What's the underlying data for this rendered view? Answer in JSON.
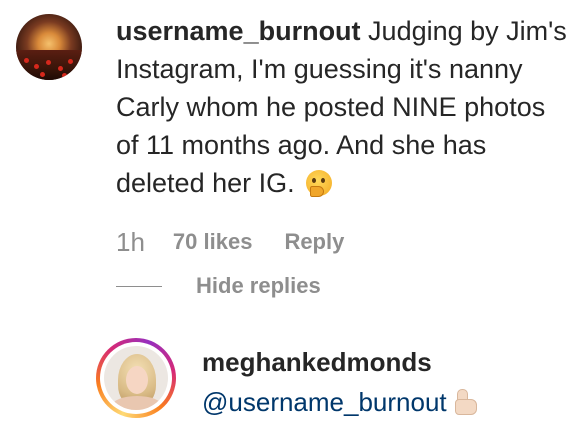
{
  "comment": {
    "username": "username_burnout",
    "text": " Judging by Jim's Instagram, I'm guessing it's nanny Carly whom he posted NINE photos of 11 months ago. And she has deleted her IG. ",
    "emoji_icon": "thinking-face-emoji",
    "time": "1h",
    "likes": "70 likes",
    "reply_label": "Reply",
    "hide_replies_label": "Hide replies"
  },
  "reply": {
    "username": "meghankedmonds",
    "mention": "@username_burnout",
    "emoji_icon": "thumbs-up-emoji"
  },
  "colors": {
    "text": "#262626",
    "secondary": "#8e8e8e",
    "link": "#00376b"
  }
}
